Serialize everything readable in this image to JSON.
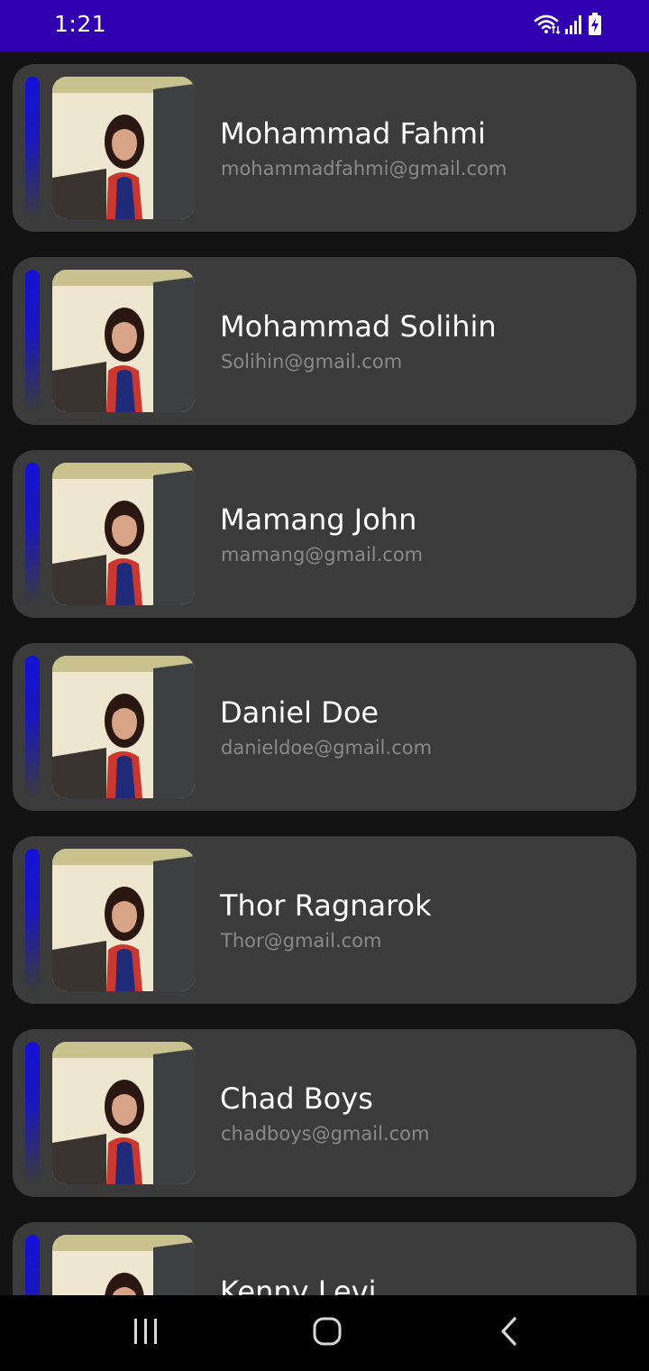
{
  "status_bar": {
    "time": "1:21",
    "background": "#3000b0",
    "icons": [
      "wifi-icon",
      "signal-icon",
      "battery-charging-icon"
    ]
  },
  "contacts": [
    {
      "name": "Mohammad Fahmi",
      "email": "mohammadfahmi@gmail.com"
    },
    {
      "name": "Mohammad Solihin",
      "email": "Solihin@gmail.com"
    },
    {
      "name": "Mamang John",
      "email": "mamang@gmail.com"
    },
    {
      "name": "Daniel Doe",
      "email": "danieldoe@gmail.com"
    },
    {
      "name": "Thor Ragnarok",
      "email": "Thor@gmail.com"
    },
    {
      "name": "Chad Boys",
      "email": "chadboys@gmail.com"
    },
    {
      "name": "Kenny Levi",
      "email": ""
    }
  ],
  "colors": {
    "background": "#121212",
    "card": "#3b3b3b",
    "accent": "#1411d8",
    "name_text": "#ffffff",
    "email_text": "#8a8a8a"
  },
  "nav_bar": {
    "icons": [
      "recent-apps-icon",
      "home-icon",
      "back-icon"
    ]
  }
}
